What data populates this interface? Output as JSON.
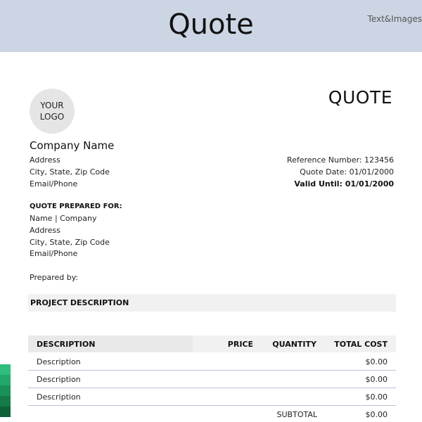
{
  "banner": {
    "title": "Quote",
    "brand": "Text&Images"
  },
  "logo": {
    "line1": "YOUR",
    "line2": "LOGO"
  },
  "document": {
    "title": "QUOTE"
  },
  "company": {
    "name": "Company Name",
    "address": "Address",
    "city": "City, State, Zip Code",
    "contact": "Email/Phone"
  },
  "meta": {
    "reference": "Reference Number: 123456",
    "quote_date": "Quote Date: 01/01/2000",
    "valid_until": "Valid Until: 01/01/2000"
  },
  "prepared_for": {
    "heading": "QUOTE PREPARED FOR:",
    "name": "Name | Company",
    "address": "Address",
    "city": "City, State, Zip Code",
    "contact": "Email/Phone"
  },
  "prepared_by": "Prepared by:",
  "project_section": "PROJECT DESCRIPTION",
  "table": {
    "headers": {
      "description": "DESCRIPTION",
      "price": "PRICE",
      "quantity": "QUANTITY",
      "total": "TOTAL COST"
    },
    "rows": [
      {
        "description": "Description",
        "price": "",
        "quantity": "",
        "total": "$0.00"
      },
      {
        "description": "Description",
        "price": "",
        "quantity": "",
        "total": "$0.00"
      },
      {
        "description": "Description",
        "price": "",
        "quantity": "",
        "total": "$0.00"
      }
    ],
    "subtotal_label": "SUBTOTAL",
    "subtotal_value": "$0.00"
  },
  "colors": {
    "banner": "#ccd5e3",
    "logo_circle": "#e5e5e5",
    "header_fill": "#f1f1f1",
    "row_divider": "#b9c0d6",
    "swatches": [
      "#2ebd7a",
      "#22a868",
      "#1a9157",
      "#137a48",
      "#0d6138"
    ]
  }
}
